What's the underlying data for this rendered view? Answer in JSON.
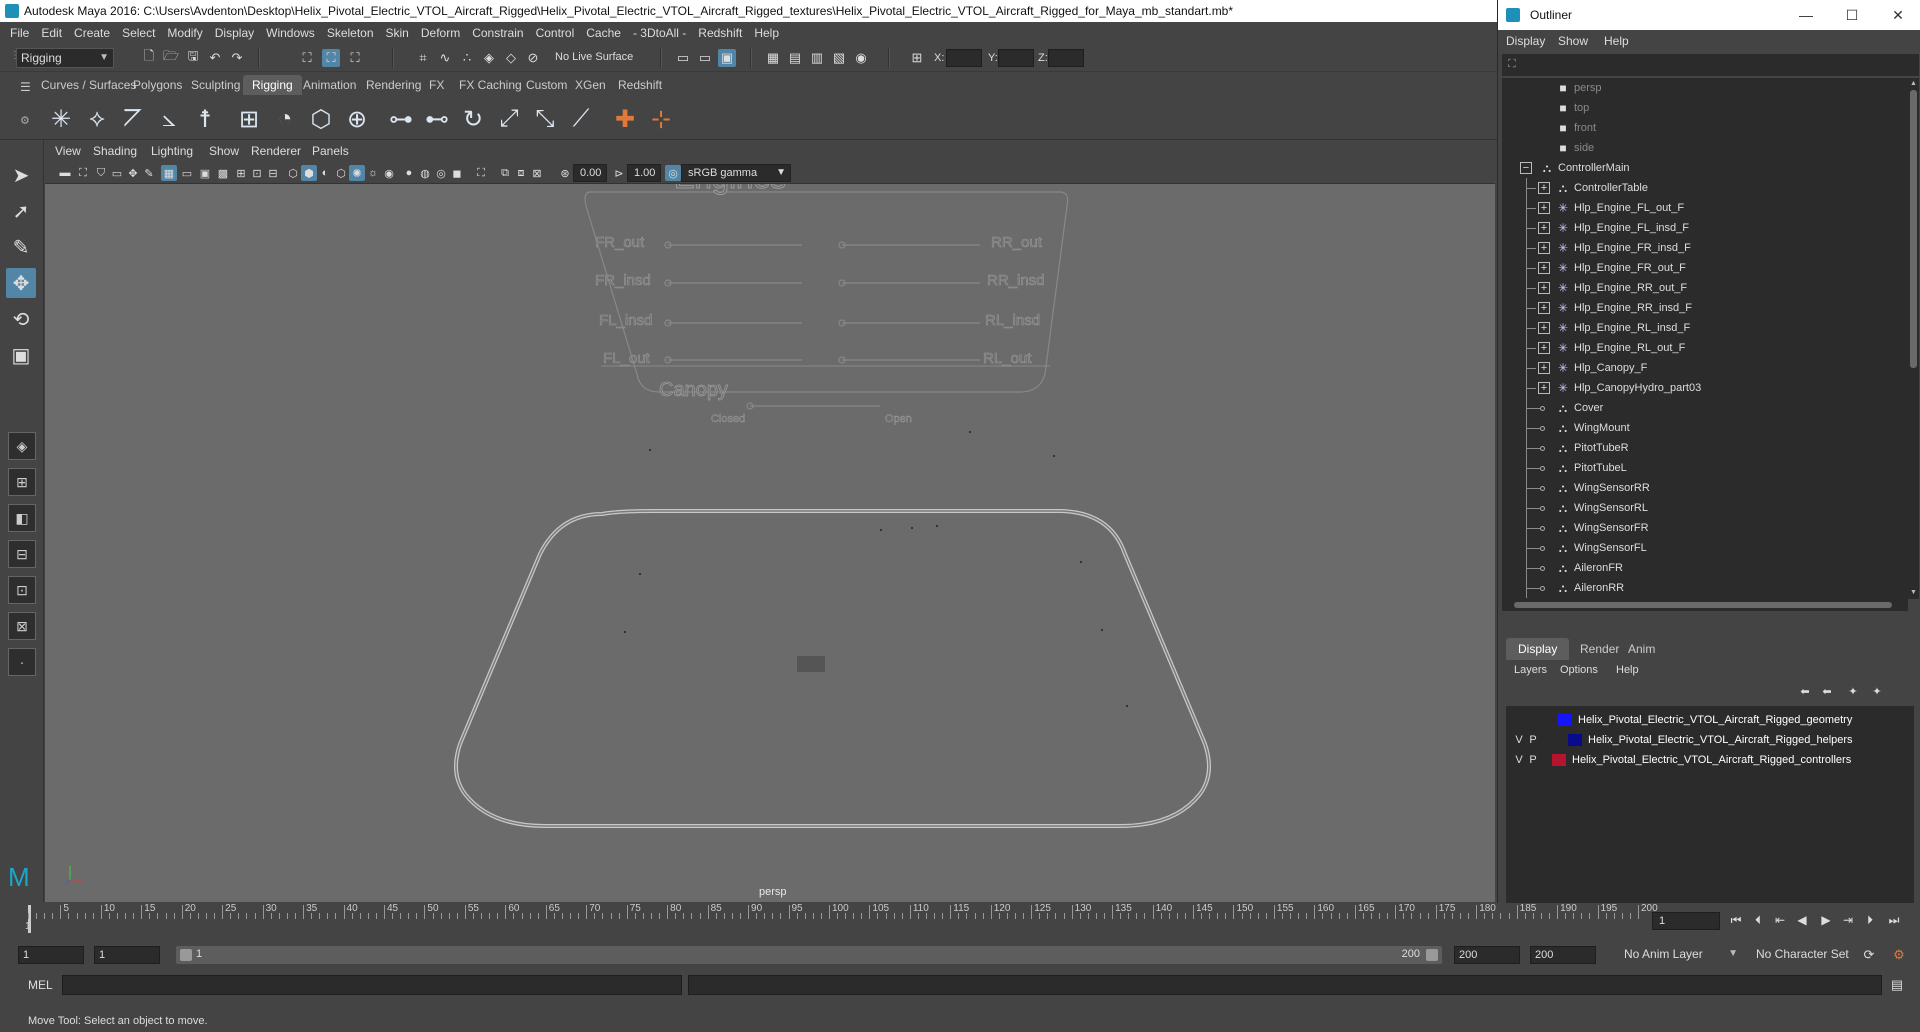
{
  "window": {
    "title": "Autodesk Maya 2016: C:\\Users\\Avdenton\\Desktop\\Helix_Pivotal_Electric_VTOL_Aircraft_Rigged\\Helix_Pivotal_Electric_VTOL_Aircraft_Rigged_textures\\Helix_Pivotal_Electric_VTOL_Aircraft_Rigged_for_Maya_mb_standart.mb*"
  },
  "menubar": [
    "File",
    "Edit",
    "Create",
    "Select",
    "Modify",
    "Display",
    "Windows",
    "Skeleton",
    "Skin",
    "Deform",
    "Constrain",
    "Control",
    "Cache",
    "- 3DtoAll -",
    "Redshift",
    "Help"
  ],
  "statusline": {
    "menuset": "Rigging",
    "live_surface": "No Live Surface",
    "x_label": "X:",
    "y_label": "Y:",
    "z_label": "Z:"
  },
  "shelf_tabs": [
    "Curves / Surfaces",
    "Polygons",
    "Sculpting",
    "Rigging",
    "Animation",
    "Rendering",
    "FX",
    "FX Caching",
    "Custom",
    "XGen",
    "Redshift"
  ],
  "shelf_active_tab": "Rigging",
  "viewport": {
    "menus": [
      "View",
      "Shading",
      "Lighting",
      "Show",
      "Renderer",
      "Panels"
    ],
    "exposure": "0.00",
    "gamma": "1.00",
    "color_space": "sRGB gamma",
    "camera_label": "persp"
  },
  "controller_panel": {
    "title": "Engines",
    "left_labels": [
      "FR_out",
      "FR_insd",
      "FL_insd",
      "FL_out"
    ],
    "right_labels": [
      "RR_out",
      "RR_insd",
      "RL_insd",
      "RL_out"
    ],
    "canopy_title": "Canopy",
    "canopy_left": "Closed",
    "canopy_right": "Open"
  },
  "timeline": {
    "ticks": [
      5,
      10,
      15,
      20,
      25,
      30,
      35,
      40,
      45,
      50,
      55,
      60,
      65,
      70,
      75,
      80,
      85,
      90,
      95,
      100,
      105,
      110,
      115,
      120,
      125,
      130,
      135,
      140,
      145,
      150,
      155,
      160,
      165,
      170,
      175,
      180,
      185,
      190,
      195,
      200
    ],
    "start_marker": "1",
    "current_frame": "1"
  },
  "range": {
    "start": "1",
    "playback_start": "1",
    "slider_start": "1",
    "slider_end": "200",
    "playback_end": "200",
    "end": "200",
    "anim_layer": "No Anim Layer",
    "character_set": "No Character Set"
  },
  "cmdline": {
    "label": "MEL"
  },
  "helpline": {
    "text": "Move Tool: Select an object to move."
  },
  "outliner": {
    "title": "Outliner",
    "menus": [
      "Display",
      "Show",
      "Help"
    ],
    "items": [
      {
        "label": "persp",
        "icon": "camera-icon",
        "level": 1,
        "kind": "camera"
      },
      {
        "label": "top",
        "icon": "camera-icon",
        "level": 1,
        "kind": "camera"
      },
      {
        "label": "front",
        "icon": "camera-icon",
        "level": 1,
        "kind": "camera"
      },
      {
        "label": "side",
        "icon": "camera-icon",
        "level": 1,
        "kind": "camera"
      },
      {
        "label": "ControllerMain",
        "icon": "transform-icon",
        "level": 0,
        "kind": "expanded"
      },
      {
        "label": "ControllerTable",
        "icon": "transform-icon",
        "level": 1,
        "kind": "collapsed"
      },
      {
        "label": "Hlp_Engine_FL_out_F",
        "icon": "locator-icon",
        "level": 1,
        "kind": "collapsed"
      },
      {
        "label": "Hlp_Engine_FL_insd_F",
        "icon": "locator-icon",
        "level": 1,
        "kind": "collapsed"
      },
      {
        "label": "Hlp_Engine_FR_insd_F",
        "icon": "locator-icon",
        "level": 1,
        "kind": "collapsed"
      },
      {
        "label": "Hlp_Engine_FR_out_F",
        "icon": "locator-icon",
        "level": 1,
        "kind": "collapsed"
      },
      {
        "label": "Hlp_Engine_RR_out_F",
        "icon": "locator-icon",
        "level": 1,
        "kind": "collapsed"
      },
      {
        "label": "Hlp_Engine_RR_insd_F",
        "icon": "locator-icon",
        "level": 1,
        "kind": "collapsed"
      },
      {
        "label": "Hlp_Engine_RL_insd_F",
        "icon": "locator-icon",
        "level": 1,
        "kind": "collapsed"
      },
      {
        "label": "Hlp_Engine_RL_out_F",
        "icon": "locator-icon",
        "level": 1,
        "kind": "collapsed"
      },
      {
        "label": "Hlp_Canopy_F",
        "icon": "locator-icon",
        "level": 1,
        "kind": "collapsed"
      },
      {
        "label": "Hlp_CanopyHydro_part03",
        "icon": "locator-icon",
        "level": 1,
        "kind": "collapsed"
      },
      {
        "label": "Cover",
        "icon": "transform-icon",
        "level": 1,
        "kind": "leaf"
      },
      {
        "label": "WingMount",
        "icon": "transform-icon",
        "level": 1,
        "kind": "leaf"
      },
      {
        "label": "PitotTubeR",
        "icon": "transform-icon",
        "level": 1,
        "kind": "leaf"
      },
      {
        "label": "PitotTubeL",
        "icon": "transform-icon",
        "level": 1,
        "kind": "leaf"
      },
      {
        "label": "WingSensorRR",
        "icon": "transform-icon",
        "level": 1,
        "kind": "leaf"
      },
      {
        "label": "WingSensorRL",
        "icon": "transform-icon",
        "level": 1,
        "kind": "leaf"
      },
      {
        "label": "WingSensorFR",
        "icon": "transform-icon",
        "level": 1,
        "kind": "leaf"
      },
      {
        "label": "WingSensorFL",
        "icon": "transform-icon",
        "level": 1,
        "kind": "leaf"
      },
      {
        "label": "AileronFR",
        "icon": "transform-icon",
        "level": 1,
        "kind": "leaf"
      },
      {
        "label": "AileronRR",
        "icon": "transform-icon",
        "level": 1,
        "kind": "leaf"
      }
    ]
  },
  "layers": {
    "tabs": [
      "Display",
      "Render",
      "Anim"
    ],
    "menus": [
      "Layers",
      "Options",
      "Help"
    ],
    "rows": [
      {
        "v": "",
        "p": "",
        "color": "#1414ff",
        "name": "Helix_Pivotal_Electric_VTOL_Aircraft_Rigged_geometry"
      },
      {
        "v": "V",
        "p": "P",
        "color": "#0a0a8c",
        "name": "Helix_Pivotal_Electric_VTOL_Aircraft_Rigged_helpers"
      },
      {
        "v": "V",
        "p": "P",
        "color": "#b4142d",
        "name": "Helix_Pivotal_Electric_VTOL_Aircraft_Rigged_controllers"
      }
    ]
  }
}
